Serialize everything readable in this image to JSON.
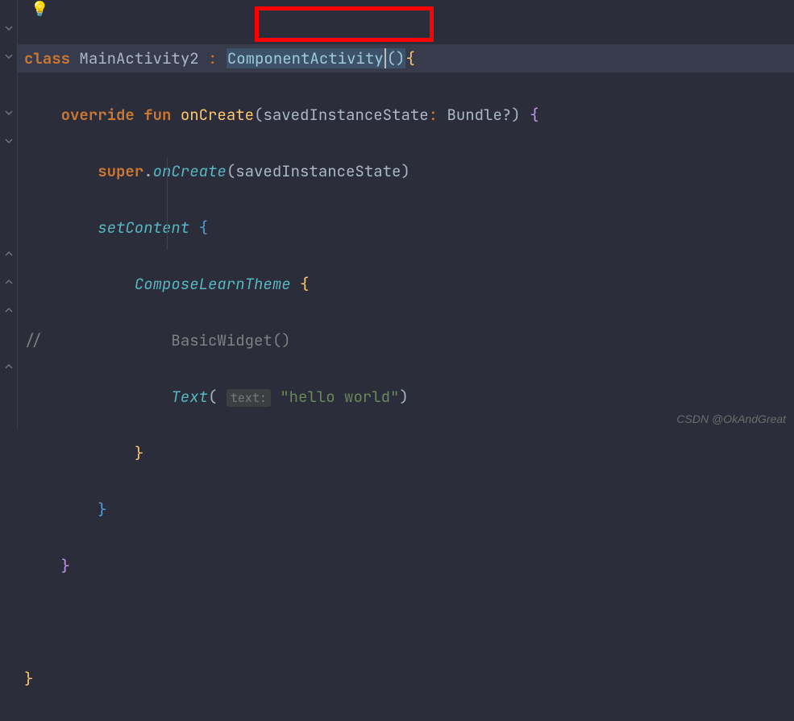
{
  "code": {
    "l1": {
      "kw_class": "class",
      "name": "MainActivity2",
      "colon": " : ",
      "supertype": "ComponentActivity",
      "parens": "()",
      "brace": "{"
    },
    "l2": {
      "kw_override": "override",
      "kw_fun": "fun",
      "fn": "onCreate",
      "param_name": "savedInstanceState",
      "param_type": "Bundle?",
      "brace": " {"
    },
    "l3": {
      "kw_super": "super",
      "dot": ".",
      "fn": "onCreate",
      "arg": "savedInstanceState"
    },
    "l4": {
      "fn": "setContent",
      "brace": " {"
    },
    "l5": {
      "fn": "ComposeLearnTheme",
      "brace": " {"
    },
    "l6": {
      "comment": "//",
      "fn": "BasicWidget()"
    },
    "l7": {
      "fn": "Text",
      "hint": "text:",
      "str": "\"hello world\""
    },
    "l8": {
      "brace": "}"
    },
    "l9": {
      "brace": "}"
    },
    "l10": {
      "brace": "}"
    },
    "l11": {
      "brace": "}"
    }
  },
  "watermark": "CSDN @OkAndGreat"
}
